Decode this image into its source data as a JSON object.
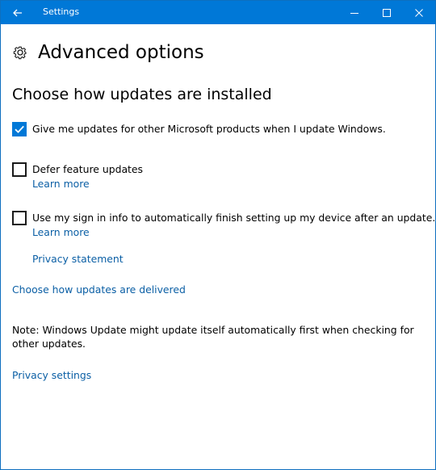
{
  "window": {
    "title": "Settings"
  },
  "titlebar_buttons": {
    "back": "back-arrow",
    "minimize": "minimize",
    "maximize": "maximize",
    "close": "close"
  },
  "page": {
    "icon": "gear-icon",
    "title": "Advanced options"
  },
  "install_section": {
    "title": "Choose how updates are installed",
    "options": [
      {
        "label": "Give me updates for other Microsoft products when I update Windows.",
        "checked": true
      },
      {
        "label": "Defer feature updates",
        "checked": false,
        "link": "Learn more"
      },
      {
        "label": "Use my sign in info to automatically finish setting up my device after an update.",
        "checked": false,
        "link": "Learn more"
      }
    ],
    "privacy_statement": "Privacy statement"
  },
  "delivery_link": "Choose how updates are delivered",
  "note": "Note: Windows Update might update itself automatically first when checking for other updates.",
  "privacy_settings_link": "Privacy settings",
  "colors": {
    "titlebar": "#0078d7",
    "accent": "#0078d7",
    "link": "#0b5fa5"
  }
}
